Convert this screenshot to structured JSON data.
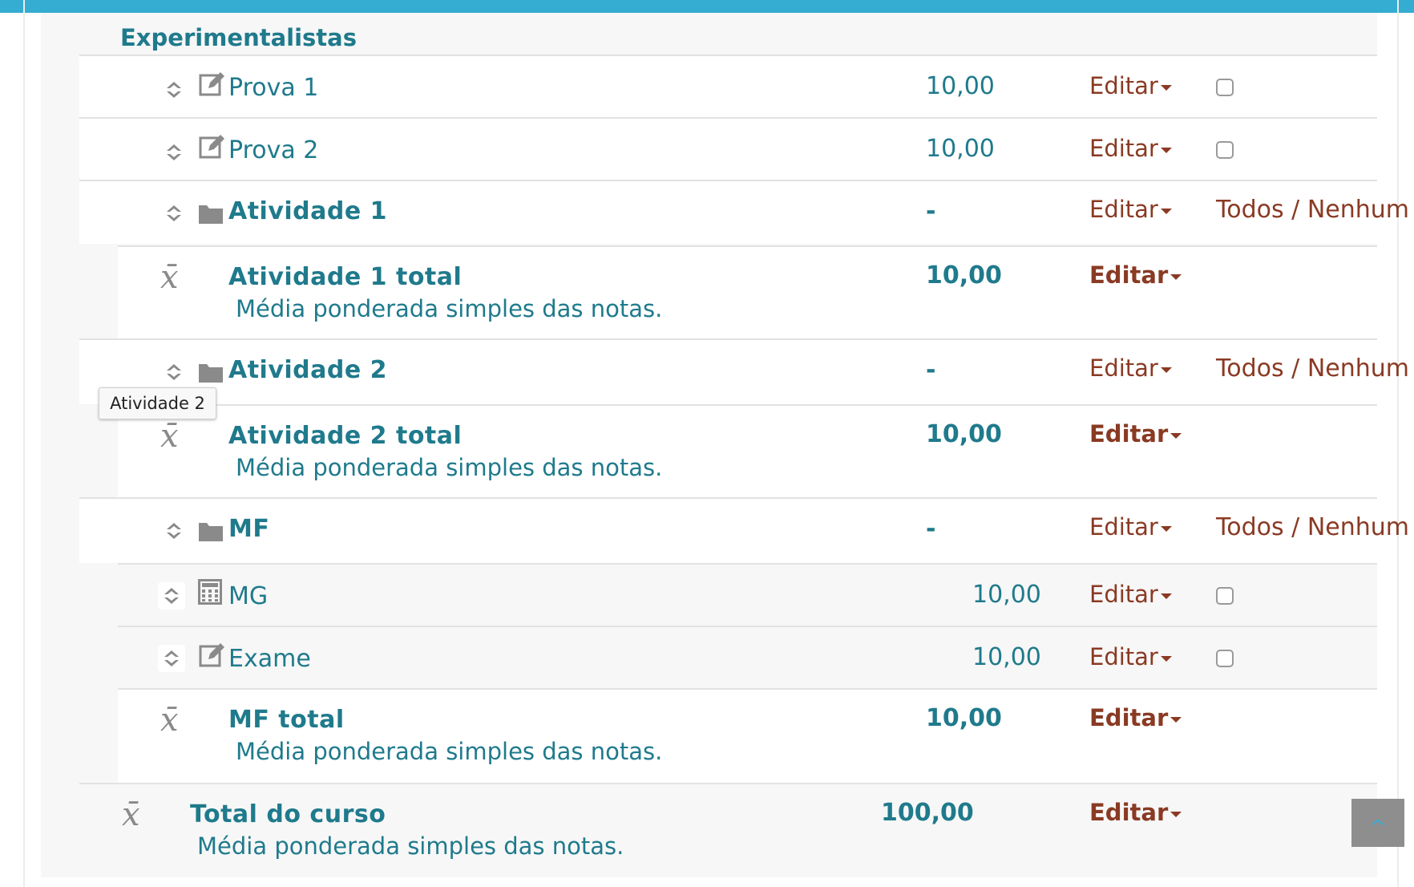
{
  "category": {
    "title": "Experimentalistas"
  },
  "actions": {
    "edit_label": "Editar",
    "select_all": "Todos",
    "select_sep": "/",
    "select_none": "Nenhum"
  },
  "items": [
    {
      "name": "Prova 1",
      "value": "10,00",
      "type": "assignment"
    },
    {
      "name": "Prova 2",
      "value": "10,00",
      "type": "assignment"
    },
    {
      "name": "Atividade 1",
      "value": "-",
      "type": "category"
    },
    {
      "name": "Atividade 1 total",
      "value": "10,00",
      "type": "category-total",
      "description": "Média ponderada simples das notas."
    },
    {
      "name": "Atividade 2",
      "value": "-",
      "type": "category"
    },
    {
      "name": "Atividade 2 total",
      "value": "10,00",
      "type": "category-total",
      "description": "Média ponderada simples das notas."
    },
    {
      "name": "MF",
      "value": "-",
      "type": "category"
    },
    {
      "name": "MG",
      "value": "10,00",
      "type": "calculated"
    },
    {
      "name": "Exame",
      "value": "10,00",
      "type": "assignment"
    },
    {
      "name": "MF total",
      "value": "10,00",
      "type": "category-total",
      "description": "Média ponderada simples das notas."
    }
  ],
  "course_total": {
    "name": "Total do curso",
    "value": "100,00",
    "description": "Média ponderada simples das notas."
  },
  "tooltip": {
    "text": "Atividade 2"
  },
  "icons": {
    "move": "move-icon",
    "assignment": "edit-square-icon",
    "folder": "folder-icon",
    "calculator": "calculator-icon",
    "total": "x-bar-icon",
    "scroll_top": "chevron-up-icon"
  },
  "colors": {
    "accent": "#35acd2",
    "link": "#1f7a8c",
    "action": "#8a3a23",
    "icon": "#8a8a8a"
  }
}
